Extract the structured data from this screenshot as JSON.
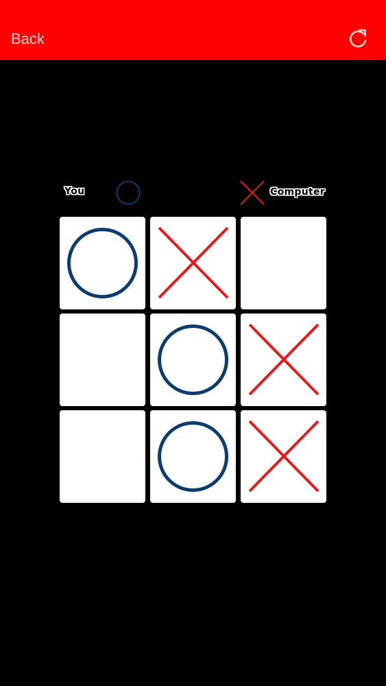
{
  "header": {
    "back_label": "Back",
    "refresh_icon": "refresh-icon"
  },
  "players": {
    "you": {
      "label": "You",
      "mark": "O"
    },
    "computer": {
      "label": "Computer",
      "mark": "X"
    }
  },
  "colors": {
    "header_bg": "#ff0000",
    "background": "#000000",
    "o_mark": "#0d3d6e",
    "x_mark": "#e8191b",
    "cell_bg": "#ffffff"
  },
  "board": [
    [
      "O",
      "X",
      ""
    ],
    [
      "",
      "O",
      "X"
    ],
    [
      "",
      "O",
      "X"
    ]
  ]
}
